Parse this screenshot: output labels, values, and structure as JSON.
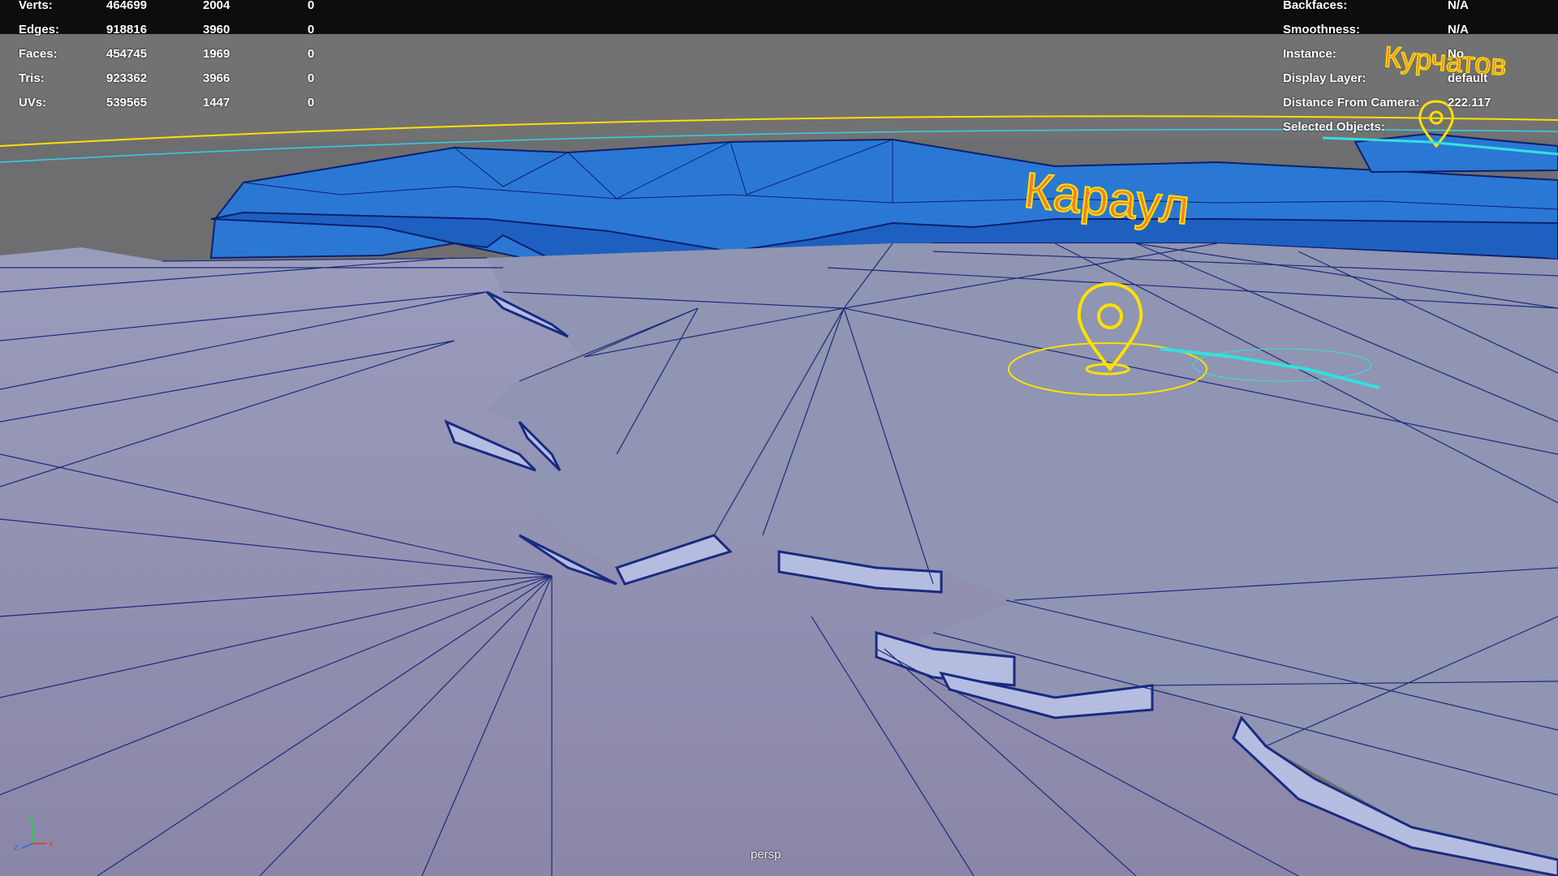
{
  "stats": {
    "rows": [
      {
        "label": "Verts:",
        "total": "464699",
        "selected": "2004",
        "extra": "0"
      },
      {
        "label": "Edges:",
        "total": "918816",
        "selected": "3960",
        "extra": "0"
      },
      {
        "label": "Faces:",
        "total": "454745",
        "selected": "1969",
        "extra": "0"
      },
      {
        "label": "Tris:",
        "total": "923362",
        "selected": "3966",
        "extra": "0"
      },
      {
        "label": "UVs:",
        "total": "539565",
        "selected": "1447",
        "extra": "0"
      }
    ]
  },
  "object_info": {
    "rows": [
      {
        "label": "Backfaces:",
        "value": "N/A"
      },
      {
        "label": "Smoothness:",
        "value": "N/A"
      },
      {
        "label": "Instance:",
        "value": "No"
      },
      {
        "label": "Display Layer:",
        "value": "default"
      },
      {
        "label": "Distance From Camera:",
        "value": "222.117"
      },
      {
        "label": "Selected Objects:",
        "value": ""
      }
    ]
  },
  "scene": {
    "city_labels": [
      "Караул",
      "Курчатов"
    ],
    "camera": "persp"
  },
  "axis": {
    "x": "x",
    "y": "y",
    "z": "z"
  },
  "colors": {
    "background": "#6e6e70",
    "terrain": "#8a8fb0",
    "region": "#2f6fd0",
    "selection": "#ffe000",
    "highlight": "#33e0e0"
  }
}
